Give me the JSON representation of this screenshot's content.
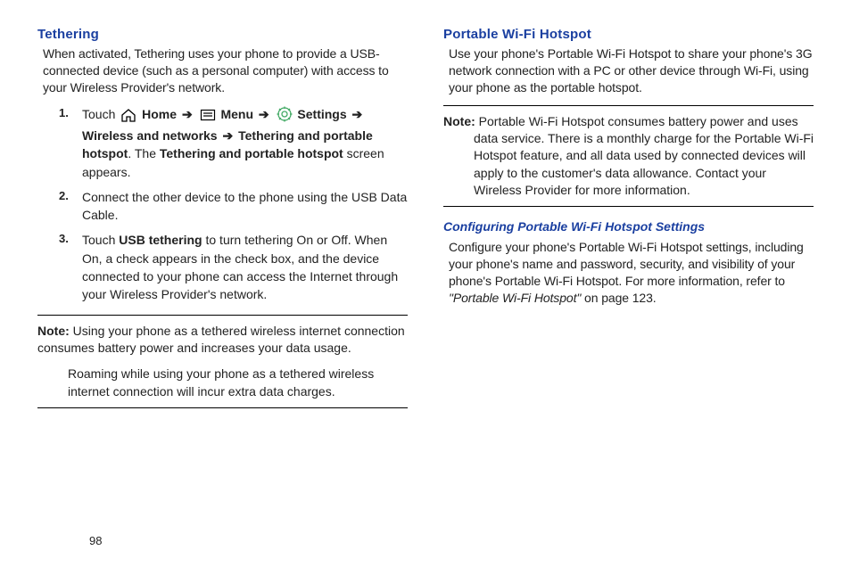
{
  "left": {
    "heading": "Tethering",
    "intro": "When activated, Tethering uses your phone to provide a USB-connected device (such as a personal computer) with access to your Wireless Provider's network.",
    "step1_touch": "Touch",
    "step1_home": "Home",
    "step1_menu": "Menu",
    "step1_settings": "Settings",
    "step1_wireless": "Wireless and networks",
    "step1_tether": "Tethering and portable hotspot",
    "step1_tail_a": ". The ",
    "step1_tail_b": "Tethering and portable hotspot",
    "step1_tail_c": " screen appears.",
    "step2": "Connect the other device to the phone using the USB Data Cable.",
    "step3_a": "Touch ",
    "step3_b": "USB tethering",
    "step3_c": " to turn tethering On or Off. When On, a check appears in the check box, and the device connected to your phone can access the Internet through your Wireless Provider's network.",
    "note_label": "Note:",
    "note1_a": " Using your phone as a tethered wireless internet connection consumes battery power and increases your data usage.",
    "note1_b": "Roaming while using your phone as a tethered wireless internet connection will incur extra data charges."
  },
  "right": {
    "heading": "Portable Wi-Fi Hotspot",
    "intro": "Use your phone's Portable Wi-Fi Hotspot to share your phone's 3G network connection with a PC or other device through Wi-Fi, using your phone as the portable hotspot.",
    "note_label": "Note:",
    "note": " Portable Wi-Fi Hotspot consumes battery power and uses data service. There is a monthly charge for the Portable Wi-Fi Hotspot feature, and all data used by connected devices will apply to the customer's data allowance. Contact your Wireless Provider for more information.",
    "subheading": "Configuring Portable Wi-Fi Hotspot Settings",
    "config_a": "Configure your phone's Portable Wi-Fi Hotspot settings, including your phone's name and password, security, and visibility of your phone's Portable Wi-Fi Hotspot. For more information, refer to ",
    "config_ref": "\"Portable Wi-Fi Hotspot\"",
    "config_b": "  on page 123."
  },
  "arrow": "➔",
  "pagenum": "98"
}
